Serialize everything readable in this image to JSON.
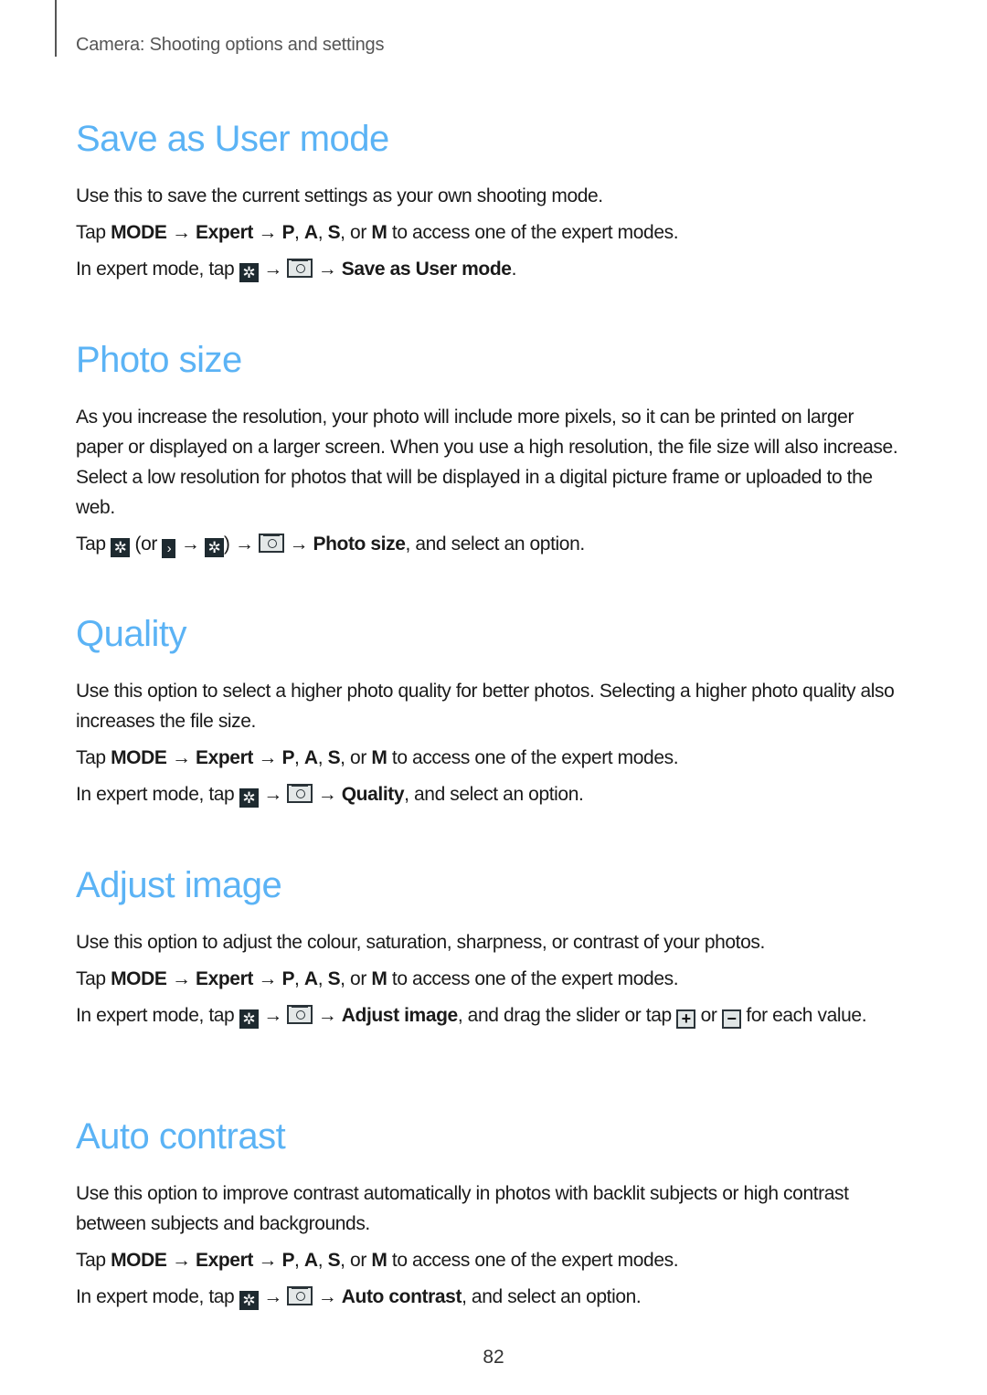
{
  "header": {
    "running_title": "Camera: Shooting options and settings"
  },
  "icons": {
    "gear": "gear-icon",
    "camera": "camera-settings-icon",
    "chevron": "chevron-right-icon",
    "plus": "plus-icon",
    "minus": "minus-icon"
  },
  "colors": {
    "heading": "#5bb3f5",
    "body_text": "#1a1a1a",
    "header_text": "#555555"
  },
  "arrow": "→",
  "sections": [
    {
      "title": "Save as User mode",
      "paragraphs": {
        "intro": "Use this to save the current settings as your own shooting mode.",
        "step1": {
          "tap": "Tap ",
          "mode": "MODE",
          "expert": "Expert",
          "p": "P",
          "a": "A",
          "s": "S",
          "m": "M",
          "sep1": ", ",
          "sep2": ", ",
          "or": ", or ",
          "rest": " to access one of the expert modes."
        },
        "step2": {
          "prefix": "In expert mode, tap ",
          "target": "Save as User mode",
          "suffix": "."
        }
      }
    },
    {
      "title": "Photo size",
      "paragraphs": {
        "intro": "As you increase the resolution, your photo will include more pixels, so it can be printed on larger paper or displayed on a larger screen. When you use a high resolution, the file size will also increase. Select a low resolution for photos that will be displayed in a digital picture frame or uploaded to the web.",
        "step1": {
          "prefix": "Tap ",
          "or_open": " (or ",
          "close": ")",
          "target": "Photo size",
          "suffix": ", and select an option."
        }
      }
    },
    {
      "title": "Quality",
      "paragraphs": {
        "intro": "Use this option to select a higher photo quality for better photos. Selecting a higher photo quality also increases the file size.",
        "step1": {
          "tap": "Tap ",
          "mode": "MODE",
          "expert": "Expert",
          "p": "P",
          "a": "A",
          "s": "S",
          "m": "M",
          "sep1": ", ",
          "sep2": ", ",
          "or": ", or ",
          "rest": " to access one of the expert modes."
        },
        "step2": {
          "prefix": "In expert mode, tap ",
          "target": "Quality",
          "suffix": ", and select an option."
        }
      }
    },
    {
      "title": "Adjust image",
      "paragraphs": {
        "intro": "Use this option to adjust the colour, saturation, sharpness, or contrast of your photos.",
        "step1": {
          "tap": "Tap ",
          "mode": "MODE",
          "expert": "Expert",
          "p": "P",
          "a": "A",
          "s": "S",
          "m": "M",
          "sep1": ", ",
          "sep2": ", ",
          "or": ", or ",
          "rest": " to access one of the expert modes."
        },
        "step2": {
          "prefix": "In expert mode, tap ",
          "target": "Adjust image",
          "middle": ", and drag the slider or tap ",
          "or": " or ",
          "suffix": " for each value."
        }
      }
    },
    {
      "title": "Auto contrast",
      "paragraphs": {
        "intro": "Use this option to improve contrast automatically in photos with backlit subjects or high contrast between subjects and backgrounds.",
        "step1": {
          "tap": "Tap ",
          "mode": "MODE",
          "expert": "Expert",
          "p": "P",
          "a": "A",
          "s": "S",
          "m": "M",
          "sep1": ", ",
          "sep2": ", ",
          "or": ", or ",
          "rest": " to access one of the expert modes."
        },
        "step2": {
          "prefix": "In expert mode, tap ",
          "target": "Auto contrast",
          "suffix": ", and select an option."
        }
      }
    }
  ],
  "footer": {
    "page_number": "82"
  }
}
